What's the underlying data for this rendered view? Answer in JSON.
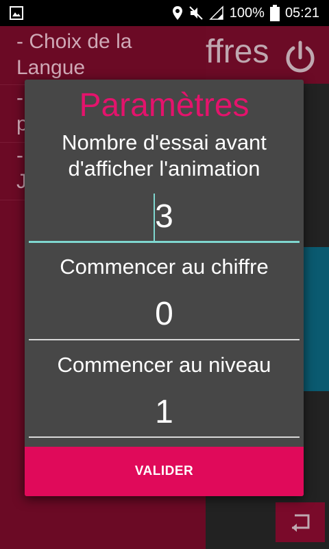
{
  "status_bar": {
    "battery_percent": "100%",
    "time": "05:21",
    "icons": [
      "image-icon",
      "location-icon",
      "mute-icon",
      "signal-icon",
      "battery-icon"
    ]
  },
  "background_app": {
    "title_fragment": "ffres",
    "drawer_items": [
      "- Choix de la Langue",
      "-",
      "p",
      "-",
      "J"
    ]
  },
  "dialog": {
    "title": "Paramètres",
    "fields": [
      {
        "label_lines": [
          "Nombre d'essai avant",
          "d'afficher l'animation"
        ],
        "value": "3"
      },
      {
        "label_lines": [
          "Commencer au chiffre"
        ],
        "value": "0"
      },
      {
        "label_lines": [
          "Commencer au niveau"
        ],
        "value": "1"
      }
    ],
    "button_label": "VALIDER"
  },
  "colors": {
    "accent": "#e4136c",
    "button": "#e00a5a",
    "dialog_bg": "#474747",
    "focus_line": "#7fd8d0"
  }
}
